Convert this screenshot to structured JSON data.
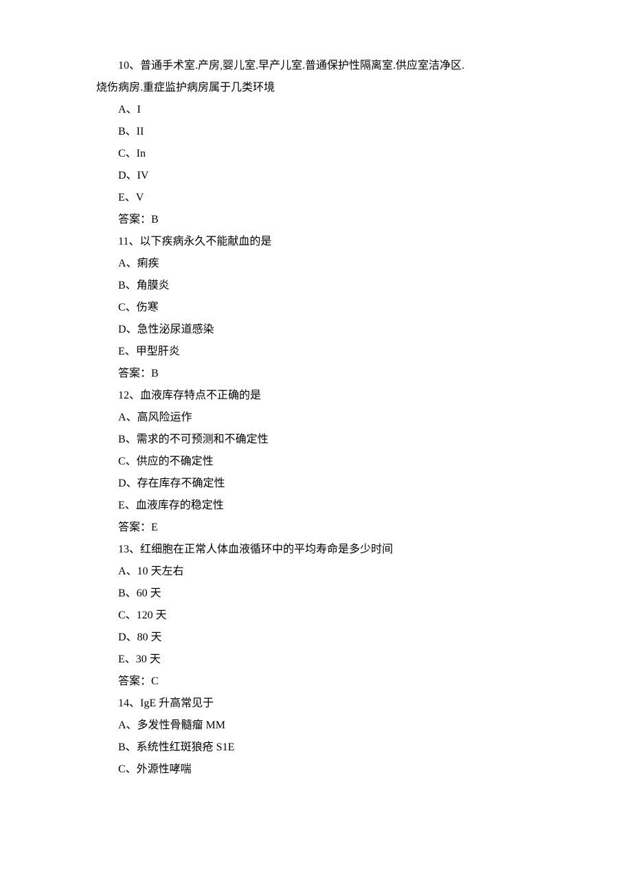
{
  "questions": [
    {
      "number": "10",
      "text_line1": "10、普通手术室.产房,婴儿室.早产儿室.普通保护性隔离室.供应室洁净区.",
      "text_line2": "烧伤病房.重症监护病房属于几类环境",
      "options": [
        "A、I",
        "B、II",
        "C、In",
        "D、IV",
        "E、V"
      ],
      "answer": "答案：B"
    },
    {
      "number": "11",
      "text_line1": "11、以下疾病永久不能献血的是",
      "options": [
        "A、痢疾",
        "B、角膜炎",
        "C、伤寒",
        "D、急性泌尿道感染",
        "E、甲型肝炎"
      ],
      "answer": "答案：B"
    },
    {
      "number": "12",
      "text_line1": "12、血液库存特点不正确的是",
      "options": [
        "A、高风险运作",
        "B、需求的不可预测和不确定性",
        "C、供应的不确定性",
        "D、存在库存不确定性",
        "E、血液库存的稳定性"
      ],
      "answer": "答案：E"
    },
    {
      "number": "13",
      "text_line1": "13、红细胞在正常人体血液循环中的平均寿命是多少时间",
      "options": [
        "A、10 天左右",
        "B、60 天",
        "C、120 天",
        "D、80 天",
        "E、30 天"
      ],
      "answer": "答案：C"
    },
    {
      "number": "14",
      "text_line1": "14、IgE 升高常见于",
      "options": [
        "A、多发性骨髓瘤 MM",
        "B、系统性红斑狼疮 S1E",
        "C、外源性哮喘"
      ]
    }
  ]
}
